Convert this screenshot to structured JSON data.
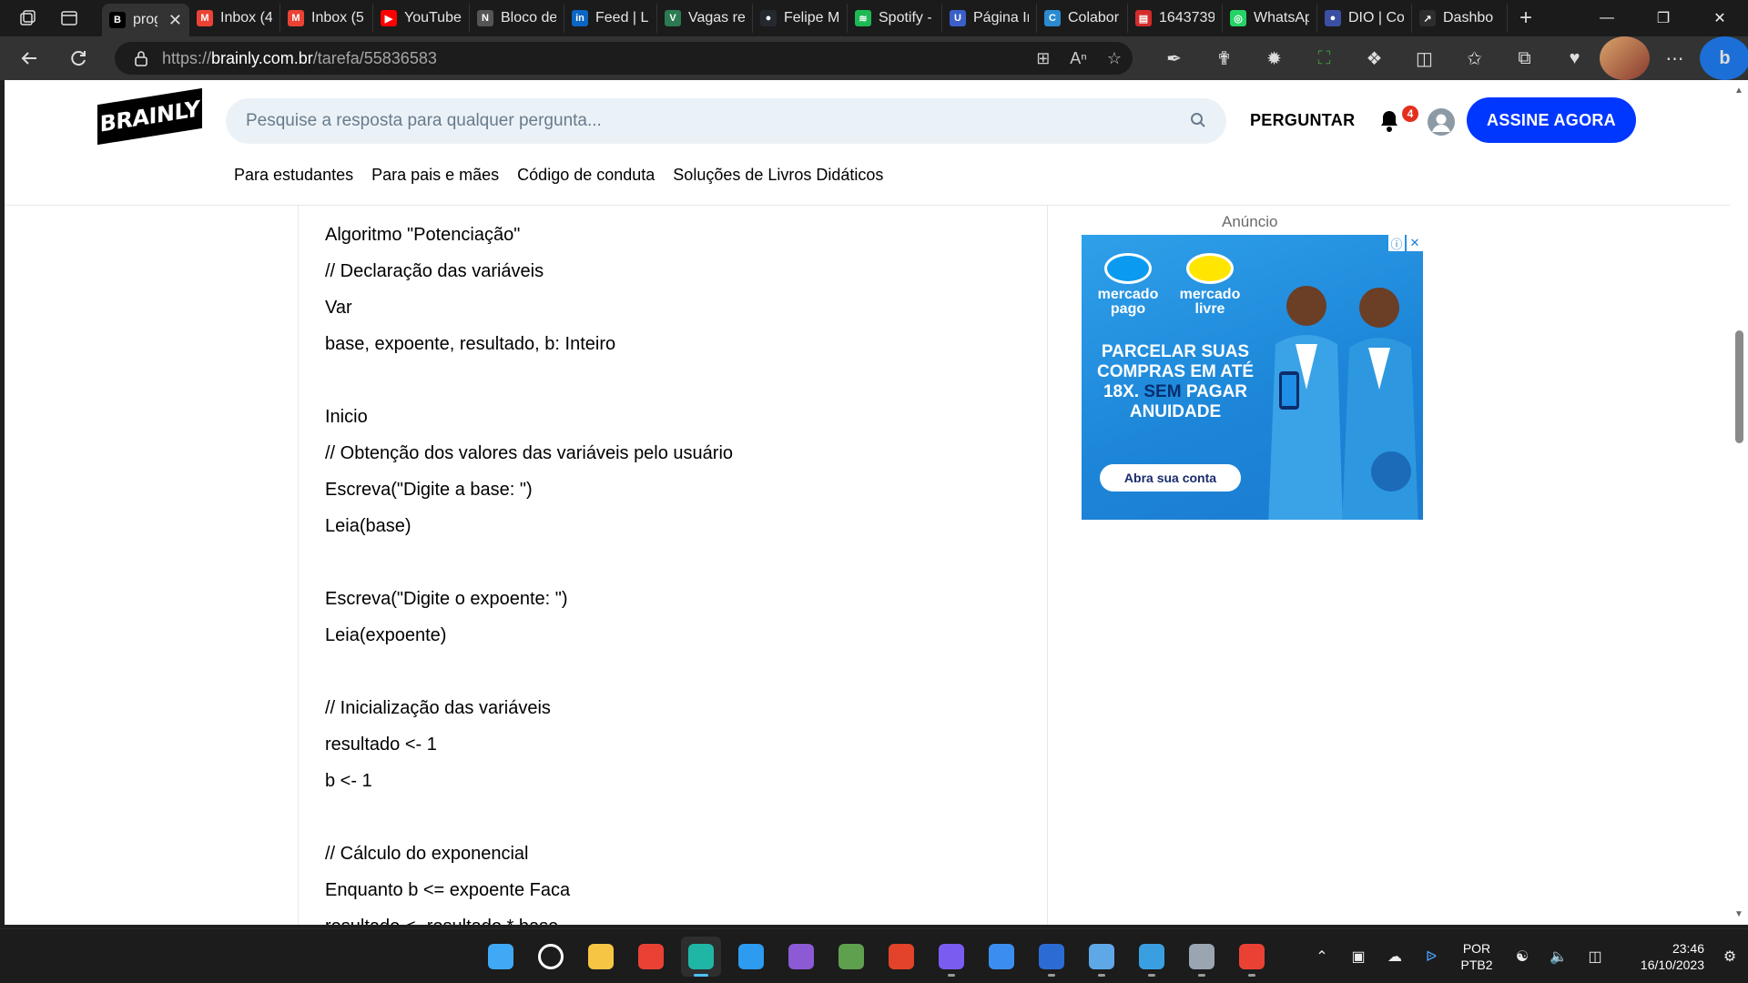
{
  "browser": {
    "tabs": [
      {
        "title": "prog",
        "favicon_color": "#000000",
        "favicon_glyph": "B",
        "active": true
      },
      {
        "title": "Inbox (4",
        "favicon_color": "#ea4335",
        "favicon_glyph": "M"
      },
      {
        "title": "Inbox (5",
        "favicon_color": "#ea4335",
        "favicon_glyph": "M"
      },
      {
        "title": "YouTube",
        "favicon_color": "#ff0000",
        "favicon_glyph": "▶"
      },
      {
        "title": "Bloco de",
        "favicon_color": "#555555",
        "favicon_glyph": "N"
      },
      {
        "title": "Feed | Li",
        "favicon_color": "#0a66c2",
        "favicon_glyph": "in"
      },
      {
        "title": "Vagas re",
        "favicon_color": "#2b7a52",
        "favicon_glyph": "V"
      },
      {
        "title": "Felipe M",
        "favicon_color": "#24292f",
        "favicon_glyph": "●"
      },
      {
        "title": "Spotify -",
        "favicon_color": "#1db954",
        "favicon_glyph": "≋"
      },
      {
        "title": "Página Ir",
        "favicon_color": "#3b5fc9",
        "favicon_glyph": "U"
      },
      {
        "title": "Colabor",
        "favicon_color": "#2b8ad1",
        "favicon_glyph": "C"
      },
      {
        "title": "1643739",
        "favicon_color": "#d42b2b",
        "favicon_glyph": "▤"
      },
      {
        "title": "WhatsAp",
        "favicon_color": "#25d366",
        "favicon_glyph": "◎"
      },
      {
        "title": "DIO | Co",
        "favicon_color": "#3b4fa3",
        "favicon_glyph": "●"
      },
      {
        "title": "Dashbo",
        "favicon_color": "#2d2d2d",
        "favicon_glyph": "↗"
      }
    ],
    "new_tab": "+",
    "url_prefix": "https://",
    "url_domain": "brainly.com.br",
    "url_path": "/tarefa/55836583"
  },
  "brainly": {
    "logo": "BRAINLY",
    "search_placeholder": "Pesquise a resposta para qualquer pergunta...",
    "ask_label": "PERGUNTAR",
    "notification_count": "4",
    "subscribe_label": "ASSINE AGORA",
    "subnav": [
      "Para estudantes",
      "Para pais e mães",
      "Código de conduta",
      "Soluções de Livros Didáticos"
    ]
  },
  "answer": {
    "lines": [
      "Algoritmo \"Potenciação\"",
      "// Declaração das variáveis",
      "Var",
      "base, expoente, resultado, b: Inteiro",
      "",
      "Inicio",
      "// Obtenção dos valores das variáveis pelo usuário",
      "Escreva(\"Digite a base: \")",
      "Leia(base)",
      "",
      "Escreva(\"Digite o expoente: \")",
      "Leia(expoente)",
      "",
      "// Inicialização das variáveis",
      "resultado <- 1",
      "b <- 1",
      "",
      "// Cálculo do exponencial",
      "Enquanto b <= expoente Faca",
      "resultado <- resultado * base"
    ]
  },
  "ad": {
    "label": "Anúncio",
    "brand1_line1": "mercado",
    "brand1_line2": "pago",
    "brand2_line1": "mercado",
    "brand2_line2": "livre",
    "headline": "PARCELAR SUAS COMPRAS EM ATÉ 18X.",
    "headline_highlight": "SEM",
    "headline_tail": "PAGAR ANUIDADE",
    "cta": "Abra sua conta",
    "info_glyph": "ⓘ",
    "close_glyph": "✕"
  },
  "taskbar": {
    "apps": [
      "windows-start",
      "search",
      "file-explorer",
      "chrome",
      "edge",
      "vscode",
      "github-desktop",
      "nodejs",
      "office",
      "chart-app",
      "todo",
      "word",
      "notepad",
      "photos",
      "settings",
      "chrome-profile"
    ],
    "lang_line1": "POR",
    "lang_line2": "PTB2",
    "time": "23:46",
    "date": "16/10/2023"
  }
}
